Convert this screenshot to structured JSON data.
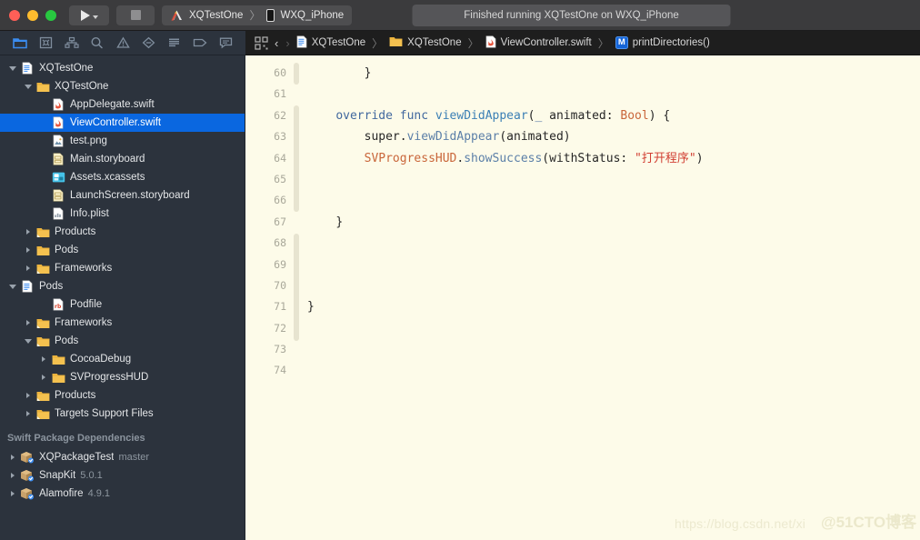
{
  "titlebar": {
    "window_controls": [
      "close",
      "minimize",
      "zoom"
    ],
    "run_button_label": "run-scheme",
    "stop_button_label": "stop-scheme",
    "scheme_name": "XQTestOne",
    "scheme_separator": "〉",
    "destination": "WXQ_iPhone",
    "status_message": "Finished running XQTestOne on WXQ_iPhone"
  },
  "navigator_toolbar": {
    "icons": [
      {
        "name": "project-navigator-icon",
        "glyph": "folder",
        "active": true
      },
      {
        "name": "source-control-navigator-icon",
        "glyph": "source-control",
        "active": false
      },
      {
        "name": "symbol-navigator-icon",
        "glyph": "hierarchy",
        "active": false
      },
      {
        "name": "find-navigator-icon",
        "glyph": "search",
        "active": false
      },
      {
        "name": "issue-navigator-icon",
        "glyph": "warning",
        "active": false
      },
      {
        "name": "test-navigator-icon",
        "glyph": "diamond",
        "active": false
      },
      {
        "name": "debug-navigator-icon",
        "glyph": "lines",
        "active": false
      },
      {
        "name": "breakpoint-navigator-icon",
        "glyph": "tag",
        "active": false
      },
      {
        "name": "report-navigator-icon",
        "glyph": "speech",
        "active": false
      }
    ]
  },
  "breadcrumb": {
    "back_arrow": "‹",
    "forward_arrow": "›",
    "items": [
      {
        "label": "XQTestOne",
        "icon": "project-icon"
      },
      {
        "label": "XQTestOne",
        "icon": "folder-icon"
      },
      {
        "label": "ViewController.swift",
        "icon": "swift-file-icon"
      },
      {
        "label": "printDirectories()",
        "icon": "method-badge-icon",
        "badge": "M"
      }
    ],
    "separator": "〉"
  },
  "sidebar": {
    "rows": [
      {
        "indent": 0,
        "twisty": "open",
        "icon": "project-icon",
        "label": "XQTestOne",
        "version": "",
        "selected": false
      },
      {
        "indent": 1,
        "twisty": "open",
        "icon": "folder-icon",
        "label": "XQTestOne",
        "version": "",
        "selected": false
      },
      {
        "indent": 2,
        "twisty": "none",
        "icon": "swift-file-icon",
        "label": "AppDelegate.swift",
        "version": "",
        "selected": false
      },
      {
        "indent": 2,
        "twisty": "none",
        "icon": "swift-file-icon",
        "label": "ViewController.swift",
        "version": "",
        "selected": true
      },
      {
        "indent": 2,
        "twisty": "none",
        "icon": "image-file-icon",
        "label": "test.png",
        "version": "",
        "selected": false
      },
      {
        "indent": 2,
        "twisty": "none",
        "icon": "storyboard-icon",
        "label": "Main.storyboard",
        "version": "",
        "selected": false
      },
      {
        "indent": 2,
        "twisty": "none",
        "icon": "assets-icon",
        "label": "Assets.xcassets",
        "version": "",
        "selected": false
      },
      {
        "indent": 2,
        "twisty": "none",
        "icon": "storyboard-icon",
        "label": "LaunchScreen.storyboard",
        "version": "",
        "selected": false
      },
      {
        "indent": 2,
        "twisty": "none",
        "icon": "plist-icon",
        "label": "Info.plist",
        "version": "",
        "selected": false
      },
      {
        "indent": 1,
        "twisty": "closed",
        "icon": "folder-badge-icon",
        "label": "Products",
        "version": "",
        "selected": false
      },
      {
        "indent": 1,
        "twisty": "closed",
        "icon": "folder-icon",
        "label": "Pods",
        "version": "",
        "selected": false
      },
      {
        "indent": 1,
        "twisty": "closed",
        "icon": "folder-badge-icon",
        "label": "Frameworks",
        "version": "",
        "selected": false
      },
      {
        "indent": 0,
        "twisty": "open",
        "icon": "project-icon",
        "label": "Pods",
        "version": "",
        "selected": false
      },
      {
        "indent": 2,
        "twisty": "none",
        "icon": "ruby-file-icon",
        "label": "Podfile",
        "version": "",
        "selected": false
      },
      {
        "indent": 1,
        "twisty": "closed",
        "icon": "folder-badge-icon",
        "label": "Frameworks",
        "version": "",
        "selected": false
      },
      {
        "indent": 1,
        "twisty": "open",
        "icon": "folder-badge-icon",
        "label": "Pods",
        "version": "",
        "selected": false
      },
      {
        "indent": 2,
        "twisty": "closed",
        "icon": "folder-icon",
        "label": "CocoaDebug",
        "version": "",
        "selected": false
      },
      {
        "indent": 2,
        "twisty": "closed",
        "icon": "folder-icon",
        "label": "SVProgressHUD",
        "version": "",
        "selected": false
      },
      {
        "indent": 1,
        "twisty": "closed",
        "icon": "folder-badge-icon",
        "label": "Products",
        "version": "",
        "selected": false
      },
      {
        "indent": 1,
        "twisty": "closed",
        "icon": "folder-badge-icon",
        "label": "Targets Support Files",
        "version": "",
        "selected": false
      }
    ],
    "section_header": "Swift Package Dependencies",
    "packages": [
      {
        "indent": 0,
        "twisty": "closed",
        "icon": "package-icon",
        "label": "XQPackageTest",
        "version": "master",
        "selected": false
      },
      {
        "indent": 0,
        "twisty": "closed",
        "icon": "package-icon",
        "label": "SnapKit",
        "version": "5.0.1",
        "selected": false
      },
      {
        "indent": 0,
        "twisty": "closed",
        "icon": "package-icon",
        "label": "Alamofire",
        "version": "4.9.1",
        "selected": false
      }
    ]
  },
  "editor": {
    "first_line_number": 60,
    "line_numbers": [
      "60",
      "61",
      "62",
      "63",
      "64",
      "65",
      "66",
      "67",
      "68",
      "69",
      "70",
      "71",
      "72",
      "73",
      "74"
    ],
    "lines": [
      {
        "number": "60",
        "tokens": [
          {
            "t": "        ",
            "c": "pln"
          },
          {
            "t": "}",
            "c": "pln"
          }
        ]
      },
      {
        "number": "61",
        "tokens": []
      },
      {
        "number": "62",
        "tokens": [
          {
            "t": "    ",
            "c": "pln"
          },
          {
            "t": "override",
            "c": "kw"
          },
          {
            "t": " ",
            "c": "pln"
          },
          {
            "t": "func",
            "c": "kw"
          },
          {
            "t": " ",
            "c": "pln"
          },
          {
            "t": "viewDidAppear",
            "c": "fn"
          },
          {
            "t": "(",
            "c": "pln"
          },
          {
            "t": "_",
            "c": "kw"
          },
          {
            "t": " animated: ",
            "c": "pln"
          },
          {
            "t": "Bool",
            "c": "typ"
          },
          {
            "t": ") {",
            "c": "pln"
          }
        ]
      },
      {
        "number": "63",
        "tokens": [
          {
            "t": "        ",
            "c": "pln"
          },
          {
            "t": "super",
            "c": "pln"
          },
          {
            "t": ".",
            "c": "pln"
          },
          {
            "t": "viewDidAppear",
            "c": "mem"
          },
          {
            "t": "(animated)",
            "c": "pln"
          }
        ]
      },
      {
        "number": "64",
        "tokens": [
          {
            "t": "        ",
            "c": "pln"
          },
          {
            "t": "SVProgressHUD",
            "c": "typ"
          },
          {
            "t": ".",
            "c": "pln"
          },
          {
            "t": "showSuccess",
            "c": "mem"
          },
          {
            "t": "(withStatus: ",
            "c": "pln"
          },
          {
            "t": "\"打开程序\"",
            "c": "str"
          },
          {
            "t": ")",
            "c": "pln"
          }
        ]
      },
      {
        "number": "65",
        "tokens": []
      },
      {
        "number": "66",
        "tokens": []
      },
      {
        "number": "67",
        "tokens": [
          {
            "t": "    ",
            "c": "pln"
          },
          {
            "t": "}",
            "c": "pln"
          }
        ]
      },
      {
        "number": "68",
        "tokens": []
      },
      {
        "number": "69",
        "tokens": []
      },
      {
        "number": "70",
        "tokens": []
      },
      {
        "number": "71",
        "tokens": [
          {
            "t": "}",
            "c": "pln"
          }
        ]
      },
      {
        "number": "72",
        "tokens": []
      },
      {
        "number": "73",
        "tokens": []
      },
      {
        "number": "74",
        "tokens": []
      }
    ],
    "watermark_url": "https://blog.csdn.net/xi",
    "watermark_brand": "@51CTO博客"
  }
}
